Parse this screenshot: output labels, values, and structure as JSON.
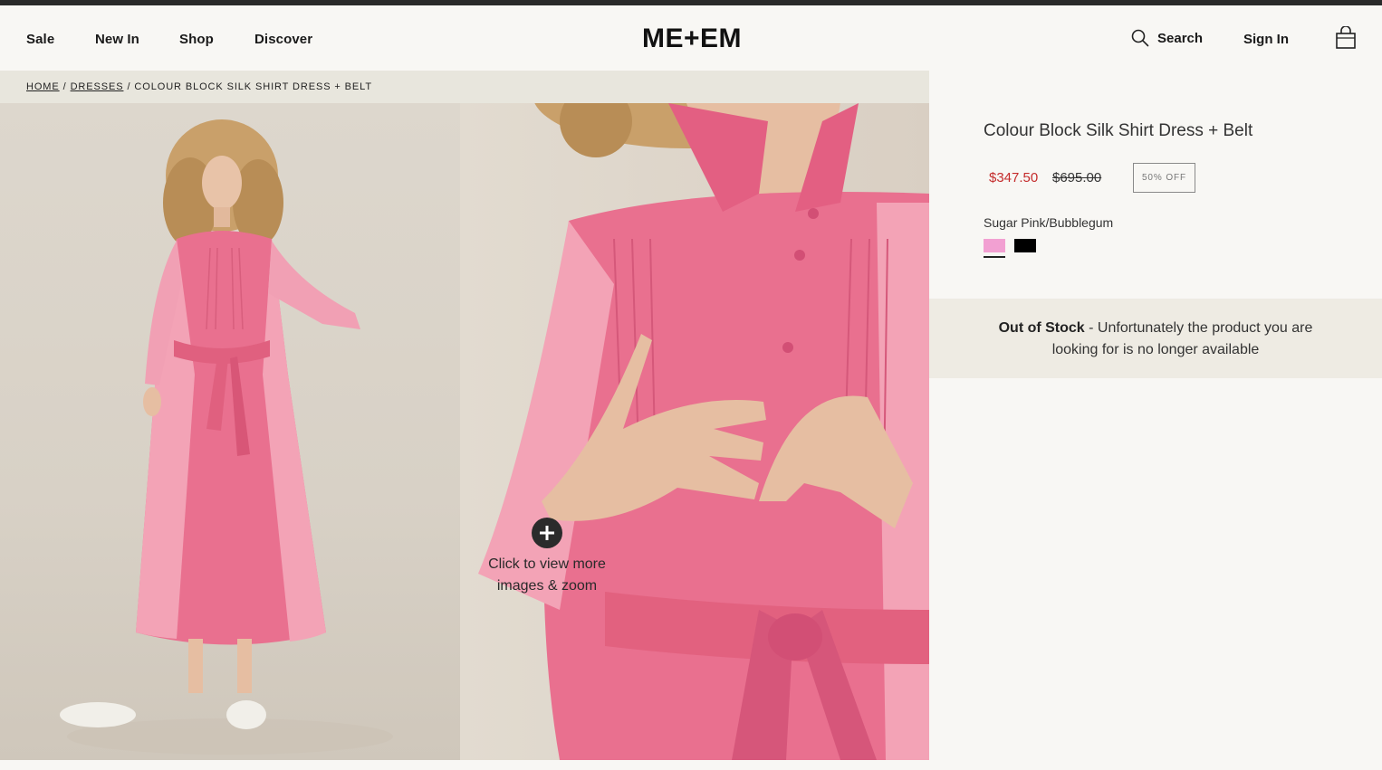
{
  "header": {
    "nav": [
      {
        "label": "Sale"
      },
      {
        "label": "New In"
      },
      {
        "label": "Shop"
      },
      {
        "label": "Discover"
      }
    ],
    "logo": "ME+EM",
    "search_label": "Search",
    "signin_label": "Sign In",
    "bag_icon": "shopping-bag-icon",
    "search_icon": "search-icon"
  },
  "breadcrumb": {
    "home": "HOME",
    "dresses": "DRESSES",
    "current": "COLOUR BLOCK SILK SHIRT DRESS + BELT",
    "separator": "/"
  },
  "gallery": {
    "zoom_hint_line1": "Click to view more",
    "zoom_hint_line2": "images & zoom",
    "zoom_icon": "plus-icon"
  },
  "product": {
    "title": "Colour Block Silk Shirt Dress + Belt",
    "price_now": "$347.50",
    "price_was": "$695.00",
    "discount_badge": "50% OFF",
    "colour_name": "Sugar Pink/Bubblegum",
    "swatches": [
      {
        "name": "Sugar Pink/Bubblegum",
        "color": "#f2a0d2",
        "selected": true
      },
      {
        "name": "Black",
        "color": "#000000",
        "selected": false
      }
    ]
  },
  "stock": {
    "status": "Out of Stock",
    "message": " - Unfortunately the product you are looking for is no longer available"
  },
  "colors": {
    "sale_price": "#c42b2b",
    "background": "#f8f7f4",
    "breadcrumb_bg": "#e8e6dd",
    "stock_bg": "#eeebe3",
    "dress_pink": "#e8708f"
  }
}
